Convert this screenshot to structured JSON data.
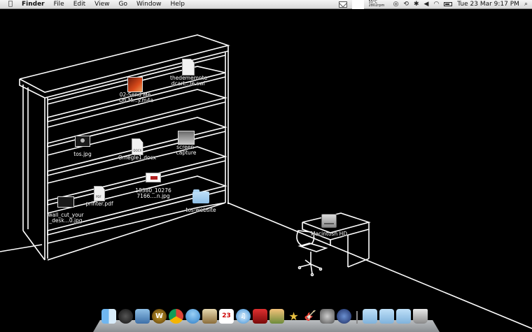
{
  "menubar": {
    "apple_icon": "apple-icon",
    "app_name": "Finder",
    "menus": [
      "File",
      "Edit",
      "View",
      "Go",
      "Window",
      "Help"
    ],
    "status": {
      "temp_line1": "55°C",
      "temp_line2": "2802rpm",
      "clock": "Tue 23 Mar  9:17 PM"
    }
  },
  "desktop_icons": {
    "m4a": "02-Send Me\nOn M...y.m4a",
    "swf": "thedememnte\ndcart...le.swf",
    "tosjpg": "tos.jpg",
    "docx": "Omegle1.docx",
    "screencap": "screen-\ncapture",
    "jpg18380": "18380_10276\n7166....n.jpg",
    "printer": "printer.pdf",
    "wallcut": "wall_cut_your\n_desk...0.jpg",
    "tosweb": "tos-website",
    "hd": "Macintosh HD"
  },
  "colors": {
    "desktop": "#000000",
    "line_art": "#ffffff",
    "menubar": "#e6e6e6"
  },
  "dock": {
    "calendar_day": "23",
    "items": [
      "finder-icon",
      "dashboard-icon",
      "mail-stamp-icon",
      "warcraft-icon",
      "chrome-icon",
      "ichat-icon",
      "photo-app-icon",
      "ical-icon",
      "itunes-icon",
      "red-book-icon",
      "iphoto-icon",
      "star-app-icon",
      "garageband-icon",
      "system-preferences-icon",
      "pencil-app-icon",
      "folder-stack-icon",
      "folder-stack-icon",
      "folder-stack-icon",
      "trash-icon"
    ]
  }
}
